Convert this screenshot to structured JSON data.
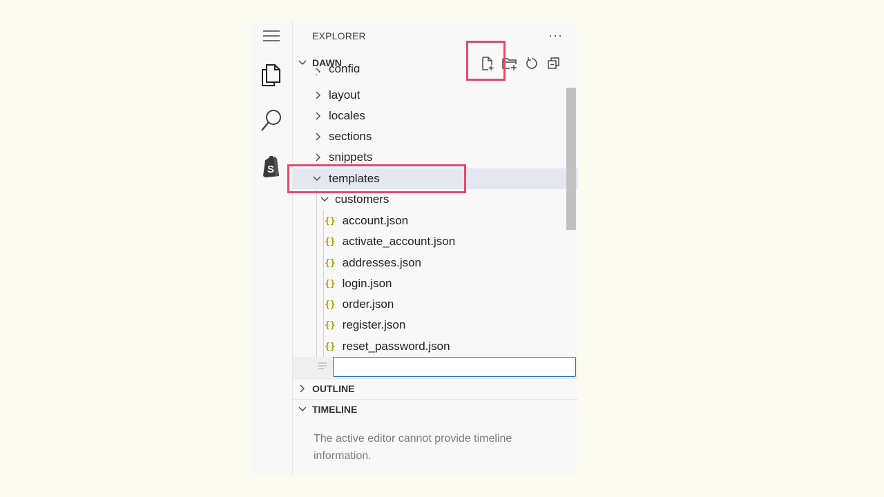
{
  "explorer": {
    "title": "EXPLORER",
    "more_label": "···"
  },
  "workspace": {
    "name": "DAWN"
  },
  "toolbar": {
    "new_file": "new-file-icon",
    "new_folder": "new-folder-icon",
    "refresh": "refresh-icon",
    "collapse": "collapse-all-icon"
  },
  "tree": {
    "config": "config",
    "layout": "layout",
    "locales": "locales",
    "sections": "sections",
    "snippets": "snippets",
    "templates": "templates",
    "customers": "customers",
    "files": [
      "account.json",
      "activate_account.json",
      "addresses.json",
      "login.json",
      "order.json",
      "register.json",
      "reset_password.json"
    ],
    "json_icon": "{}",
    "new_file_value": ""
  },
  "outline": {
    "title": "OUTLINE"
  },
  "timeline": {
    "title": "TIMELINE",
    "message": "The active editor cannot provide timeline information."
  },
  "colors": {
    "highlight": "#e14a6d",
    "selection": "#e4e6f1",
    "input_border": "#1f6fd1",
    "json_icon": "#a8a100"
  }
}
